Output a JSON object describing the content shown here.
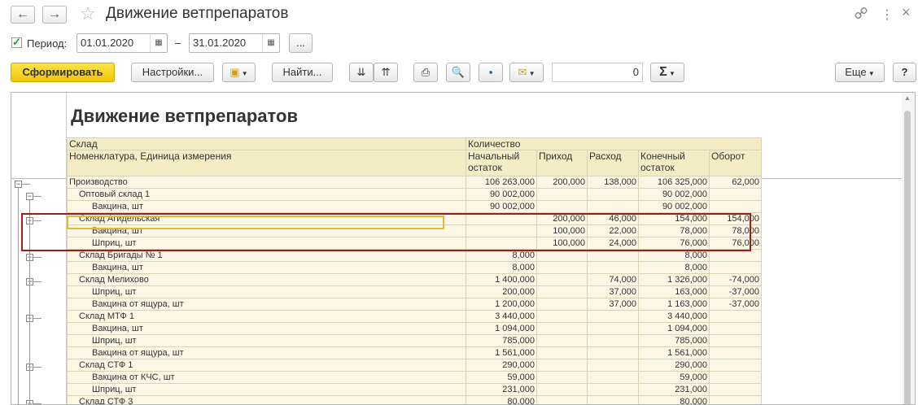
{
  "window": {
    "title": "Движение ветпрепаратов",
    "back_icon": "←",
    "forward_icon": "→",
    "star_icon": "☆",
    "link_icon": "🔗",
    "menu_icon": "⋮",
    "close_icon": "×"
  },
  "period": {
    "label": "Период:",
    "from": "01.01.2020",
    "to": "31.01.2020",
    "dash": "–",
    "more": "...",
    "checked": true
  },
  "toolbar": {
    "generate": "Сформировать",
    "settings": "Настройки...",
    "find": "Найти...",
    "sum_value": "0",
    "sigma": "Σ",
    "more": "Еще",
    "help": "?"
  },
  "report": {
    "title": "Движение ветпрепаратов",
    "header1_c0": "Склад",
    "header1_c1": "Количество",
    "header2_c0": "Номенклатура, Единица измерения",
    "col_start_1": "Начальный",
    "col_start_2": "остаток",
    "col_in": "Приход",
    "col_out": "Расход",
    "col_end_1": "Конечный",
    "col_end_2": "остаток",
    "col_turn": "Оборот",
    "rows": [
      {
        "name": "Производство",
        "start": "106 263,000",
        "in": "200,000",
        "out": "138,000",
        "end": "106 325,000",
        "turn": "62,000",
        "level": 0
      },
      {
        "name": "Оптовый склад 1",
        "start": "90 002,000",
        "in": "",
        "out": "",
        "end": "90 002,000",
        "turn": "",
        "level": 1
      },
      {
        "name": "Вакцина, шт",
        "start": "90 002,000",
        "in": "",
        "out": "",
        "end": "90 002,000",
        "turn": "",
        "level": 2
      },
      {
        "name": "Склад Агидельская",
        "start": "",
        "in": "200,000",
        "out": "46,000",
        "end": "154,000",
        "turn": "154,000",
        "level": 1
      },
      {
        "name": "Вакцина, шт",
        "start": "",
        "in": "100,000",
        "out": "22,000",
        "end": "78,000",
        "turn": "78,000",
        "level": 2
      },
      {
        "name": "Шприц, шт",
        "start": "",
        "in": "100,000",
        "out": "24,000",
        "end": "76,000",
        "turn": "76,000",
        "level": 2
      },
      {
        "name": "Склад Бригады № 1",
        "start": "8,000",
        "in": "",
        "out": "",
        "end": "8,000",
        "turn": "",
        "level": 1
      },
      {
        "name": "Вакцина, шт",
        "start": "8,000",
        "in": "",
        "out": "",
        "end": "8,000",
        "turn": "",
        "level": 2
      },
      {
        "name": "Склад Мелихово",
        "start": "1 400,000",
        "in": "",
        "out": "74,000",
        "end": "1 326,000",
        "turn": "-74,000",
        "level": 1
      },
      {
        "name": "Шприц, шт",
        "start": "200,000",
        "in": "",
        "out": "37,000",
        "end": "163,000",
        "turn": "-37,000",
        "level": 2
      },
      {
        "name": "Вакцина от ящура, шт",
        "start": "1 200,000",
        "in": "",
        "out": "37,000",
        "end": "1 163,000",
        "turn": "-37,000",
        "level": 2
      },
      {
        "name": "Склад МТФ 1",
        "start": "3 440,000",
        "in": "",
        "out": "",
        "end": "3 440,000",
        "turn": "",
        "level": 1
      },
      {
        "name": "Вакцина, шт",
        "start": "1 094,000",
        "in": "",
        "out": "",
        "end": "1 094,000",
        "turn": "",
        "level": 2
      },
      {
        "name": "Шприц, шт",
        "start": "785,000",
        "in": "",
        "out": "",
        "end": "785,000",
        "turn": "",
        "level": 2
      },
      {
        "name": "Вакцина от ящура, шт",
        "start": "1 561,000",
        "in": "",
        "out": "",
        "end": "1 561,000",
        "turn": "",
        "level": 2
      },
      {
        "name": "Склад СТФ 1",
        "start": "290,000",
        "in": "",
        "out": "",
        "end": "290,000",
        "turn": "",
        "level": 1
      },
      {
        "name": "Вакцина от КЧС, шт",
        "start": "59,000",
        "in": "",
        "out": "",
        "end": "59,000",
        "turn": "",
        "level": 2
      },
      {
        "name": "Шприц, шт",
        "start": "231,000",
        "in": "",
        "out": "",
        "end": "231,000",
        "turn": "",
        "level": 2
      },
      {
        "name": "Склад СТФ 3",
        "start": "80,000",
        "in": "",
        "out": "",
        "end": "80,000",
        "turn": "",
        "level": 1
      }
    ]
  }
}
